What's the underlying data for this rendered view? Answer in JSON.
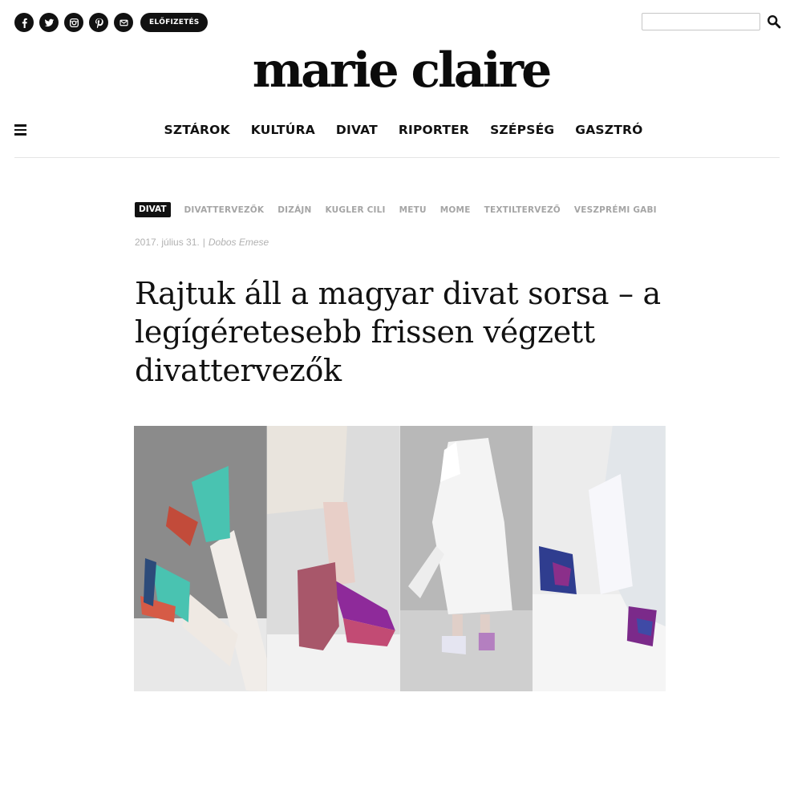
{
  "header": {
    "social_icons": [
      "facebook-icon",
      "twitter-icon",
      "instagram-icon",
      "pinterest-icon",
      "mail-icon"
    ],
    "subscribe_label": "ELŐFIZETÉS",
    "search": {
      "value": "",
      "placeholder": ""
    },
    "search_icon": "search-icon",
    "logo": "marie claire"
  },
  "nav": {
    "menu_icon": "hamburger-icon",
    "items": [
      "SZTÁROK",
      "KULTÚRA",
      "DIVAT",
      "RIPORTER",
      "SZÉPSÉG",
      "GASZTRÓ"
    ]
  },
  "article": {
    "category": "DIVAT",
    "tags": [
      "DIVATTERVEZŐK",
      "DIZÁJN",
      "KUGLER CILI",
      "METU",
      "MOME",
      "TEXTILTERVEZŐ",
      "VESZPRÉMI GABI"
    ],
    "date": "2017. július 31.",
    "separator": "|",
    "author": "Dobos Emese",
    "title": "Rajtuk áll a magyar divat sorsa – a legígéretesebb frissen végzett divattervezők"
  },
  "colors": {
    "text": "#111111",
    "muted": "#a5a5a5",
    "accent_teal": "#49c3b1",
    "accent_purple": "#8e2a9a"
  }
}
